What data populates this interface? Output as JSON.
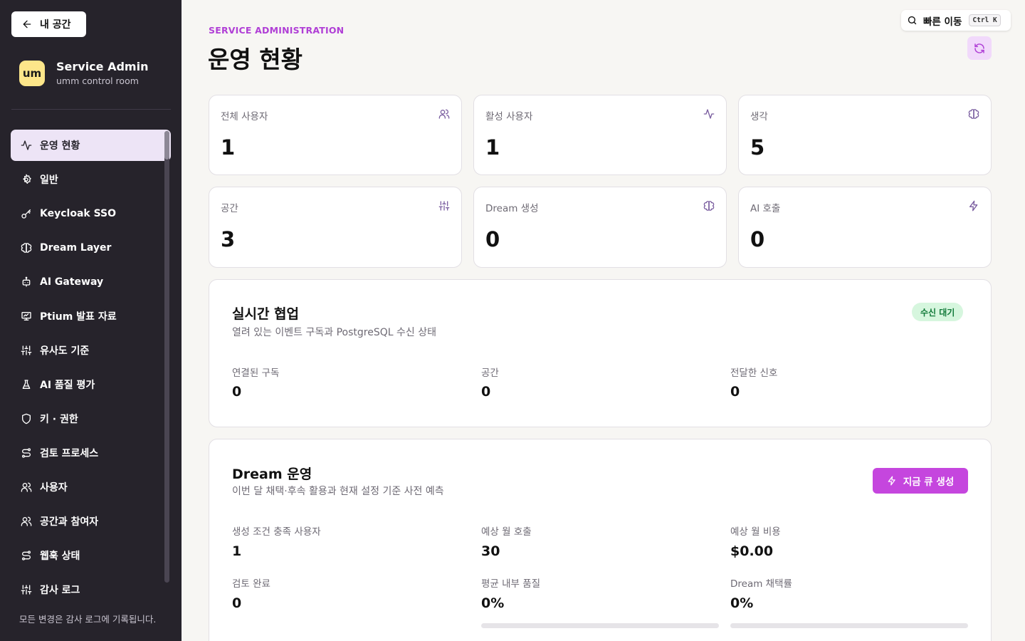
{
  "sidebar": {
    "back_label": "내 공간",
    "logo_text": "um",
    "brand_title": "Service Admin",
    "brand_subtitle": "umm control room",
    "items": [
      {
        "label": "운영 현황",
        "icon": "activity-icon",
        "active": true
      },
      {
        "label": "일반",
        "icon": "gear-icon"
      },
      {
        "label": "Keycloak SSO",
        "icon": "key-icon"
      },
      {
        "label": "Dream Layer",
        "icon": "brain-icon"
      },
      {
        "label": "AI Gateway",
        "icon": "bot-icon"
      },
      {
        "label": "Ptium 발표 자료",
        "icon": "presentation-icon"
      },
      {
        "label": "유사도 기준",
        "icon": "sliders-icon"
      },
      {
        "label": "AI 품질 평가",
        "icon": "flask-icon"
      },
      {
        "label": "키 · 권한",
        "icon": "shield-icon"
      },
      {
        "label": "검토 프로세스",
        "icon": "route-icon"
      },
      {
        "label": "사용자",
        "icon": "users-icon"
      },
      {
        "label": "공간과 참여자",
        "icon": "users-icon"
      },
      {
        "label": "웹훅 상태",
        "icon": "route-icon"
      },
      {
        "label": "감사 로그",
        "icon": "sliders-icon"
      }
    ],
    "footer": "모든 변경은 감사 로그에 기록됩니다."
  },
  "header": {
    "eyebrow": "SERVICE ADMINISTRATION",
    "title": "운영 현황",
    "quick_label": "빠른 이동",
    "quick_shortcut": "Ctrl K"
  },
  "stats": [
    {
      "label": "전체 사용자",
      "value": "1",
      "icon": "users-icon"
    },
    {
      "label": "활성 사용자",
      "value": "1",
      "icon": "activity-icon"
    },
    {
      "label": "생각",
      "value": "5",
      "icon": "brain-icon"
    },
    {
      "label": "공간",
      "value": "3",
      "icon": "sliders-icon"
    },
    {
      "label": "Dream 생성",
      "value": "0",
      "icon": "brain-icon"
    },
    {
      "label": "AI 호출",
      "value": "0",
      "icon": "zap-icon"
    }
  ],
  "realtime": {
    "title": "실시간 협업",
    "subtitle": "열려 있는 이벤트 구독과 PostgreSQL 수신 상태",
    "badge": "수신 대기",
    "metrics": [
      {
        "label": "연결된 구독",
        "value": "0"
      },
      {
        "label": "공간",
        "value": "0"
      },
      {
        "label": "전달한 신호",
        "value": "0"
      }
    ]
  },
  "dream": {
    "title": "Dream 운영",
    "subtitle": "이번 달 채택·후속 활용과 현재 설정 기준 사전 예측",
    "button_label": "지금 큐 생성",
    "metrics": [
      {
        "label": "생성 조건 충족 사용자",
        "value": "1"
      },
      {
        "label": "예상 월 호출",
        "value": "30"
      },
      {
        "label": "예상 월 비용",
        "value": "$0.00"
      },
      {
        "label": "검토 완료",
        "value": "0"
      },
      {
        "label": "평균 내부 품질",
        "value": "0%",
        "progress": 0
      },
      {
        "label": "Dream 채택률",
        "value": "0%",
        "progress": 0
      }
    ]
  },
  "colors": {
    "accent": "#c546de",
    "sidebar_bg": "#26232b",
    "active_bg": "#ede4f6",
    "badge_bg": "#d6f6de",
    "badge_text": "#127a3a"
  }
}
